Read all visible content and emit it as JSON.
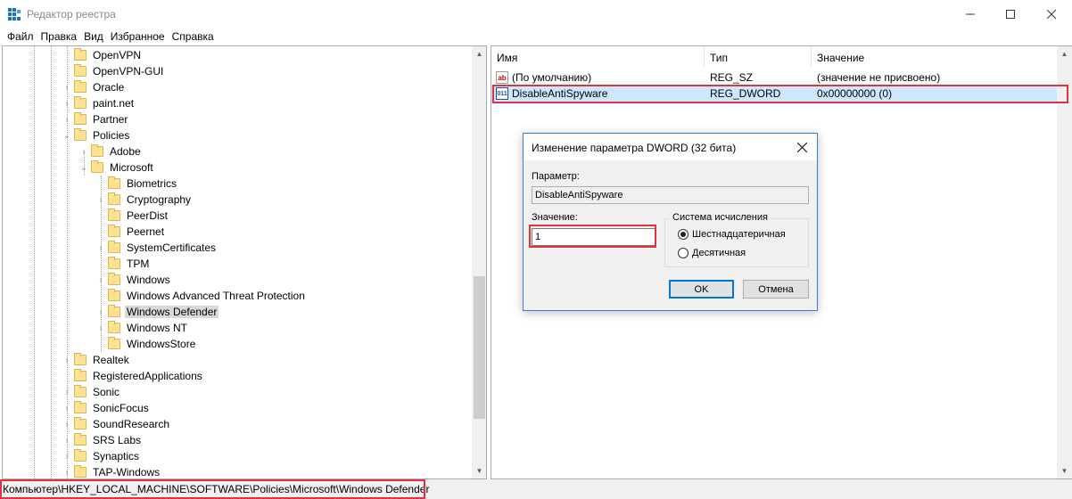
{
  "window": {
    "title": "Редактор реестра"
  },
  "menu": [
    "Файл",
    "Правка",
    "Вид",
    "Избранное",
    "Справка"
  ],
  "tree": {
    "items": [
      {
        "label": "OpenVPN",
        "expander": ""
      },
      {
        "label": "OpenVPN-GUI",
        "expander": ""
      },
      {
        "label": "Oracle",
        "expander": "›"
      },
      {
        "label": "paint.net",
        "expander": "›"
      },
      {
        "label": "Partner",
        "expander": "›"
      },
      {
        "label": "Policies",
        "expander": "⌄"
      },
      {
        "label": "Adobe",
        "expander": "›"
      },
      {
        "label": "Microsoft",
        "expander": "⌄"
      },
      {
        "label": "Biometrics",
        "expander": ""
      },
      {
        "label": "Cryptography",
        "expander": "›"
      },
      {
        "label": "PeerDist",
        "expander": ""
      },
      {
        "label": "Peernet",
        "expander": ""
      },
      {
        "label": "SystemCertificates",
        "expander": "›"
      },
      {
        "label": "TPM",
        "expander": ""
      },
      {
        "label": "Windows",
        "expander": "›"
      },
      {
        "label": "Windows Advanced Threat Protection",
        "expander": ""
      },
      {
        "label": "Windows Defender",
        "expander": "›"
      },
      {
        "label": "Windows NT",
        "expander": "›"
      },
      {
        "label": "WindowsStore",
        "expander": ""
      },
      {
        "label": "Realtek",
        "expander": "›"
      },
      {
        "label": "RegisteredApplications",
        "expander": ""
      },
      {
        "label": "Sonic",
        "expander": "›"
      },
      {
        "label": "SonicFocus",
        "expander": "›"
      },
      {
        "label": "SoundResearch",
        "expander": "›"
      },
      {
        "label": "SRS Labs",
        "expander": "›"
      },
      {
        "label": "Synaptics",
        "expander": "›"
      },
      {
        "label": "TAP-Windows",
        "expander": "›"
      }
    ]
  },
  "list": {
    "columns": [
      "Имя",
      "Тип",
      "Значение"
    ],
    "rows": [
      {
        "icon": "ab",
        "name": "(По умолчанию)",
        "type": "REG_SZ",
        "value": "(значение не присвоено)"
      },
      {
        "icon": "011",
        "name": "DisableAntiSpyware",
        "type": "REG_DWORD",
        "value": "0x00000000 (0)"
      }
    ]
  },
  "dialog": {
    "title": "Изменение параметра DWORD (32 бита)",
    "param_label": "Параметр:",
    "param_value": "DisableAntiSpyware",
    "value_label": "Значение:",
    "value_input": "1",
    "base_group_label": "Система исчисления",
    "radio_hex": "Шестнадцатеричная",
    "radio_dec": "Десятичная",
    "ok_label": "OK",
    "cancel_label": "Отмена"
  },
  "status": {
    "path": "Компьютер\\HKEY_LOCAL_MACHINE\\SOFTWARE\\Policies\\Microsoft\\Windows Defender"
  },
  "colors": {
    "highlight_box": "#e0333d",
    "selection": "#cce8ff",
    "folder": "#ffe291"
  }
}
